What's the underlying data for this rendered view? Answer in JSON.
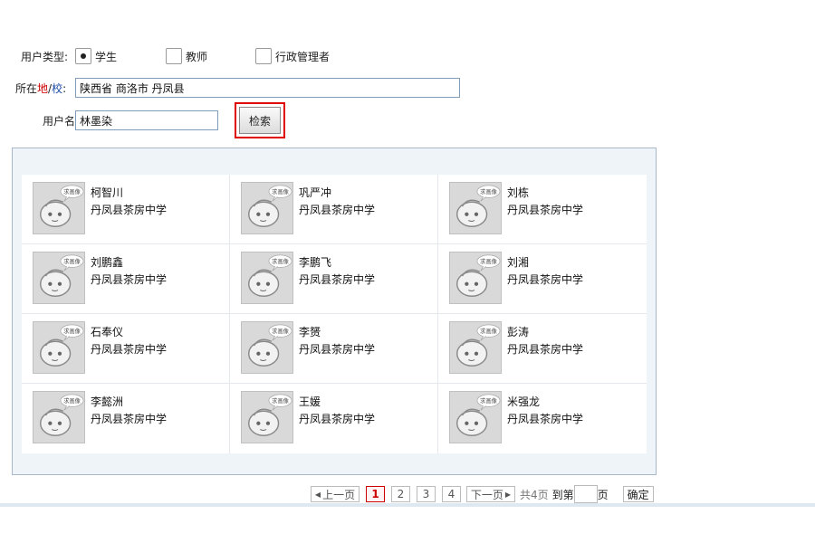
{
  "filters": {
    "user_type_label": "用户类型:",
    "user_types": [
      {
        "label": "学生",
        "checked": true
      },
      {
        "label": "教师",
        "checked": false
      },
      {
        "label": "行政管理者",
        "checked": false
      }
    ],
    "location_label_prefix": "所在",
    "location_label_di": "地",
    "location_label_sep": "/",
    "location_label_xiao": "校",
    "location_label_suffix": ":",
    "location_value": "陕西省 商洛市 丹凤县",
    "username_label": "用户名",
    "username_value": "林墨染",
    "search_button": "检索"
  },
  "results": [
    {
      "name": "柯智川",
      "school": "丹凤县茶房中学"
    },
    {
      "name": "巩严冲",
      "school": "丹凤县茶房中学"
    },
    {
      "name": "刘栋",
      "school": "丹凤县茶房中学"
    },
    {
      "name": "刘鹏鑫",
      "school": "丹凤县茶房中学"
    },
    {
      "name": "李鹏飞",
      "school": "丹凤县茶房中学"
    },
    {
      "name": "刘湘",
      "school": "丹凤县茶房中学"
    },
    {
      "name": "石奉仪",
      "school": "丹凤县茶房中学"
    },
    {
      "name": "李赟",
      "school": "丹凤县茶房中学"
    },
    {
      "name": "彭涛",
      "school": "丹凤县茶房中学"
    },
    {
      "name": "李懿洲",
      "school": "丹凤县茶房中学"
    },
    {
      "name": "王媛",
      "school": "丹凤县茶房中学"
    },
    {
      "name": "米强龙",
      "school": "丹凤县茶房中学"
    }
  ],
  "avatar_badge": "求画像",
  "pagination": {
    "prev": "上一页",
    "pages": [
      "1",
      "2",
      "3",
      "4"
    ],
    "current": "1",
    "next": "下一页",
    "total": "共4页",
    "goto_prefix": "到第",
    "goto_suffix": "页",
    "confirm": "确定"
  },
  "colors": {
    "accent_red": "#e00000",
    "link_blue": "#1a4aa5"
  }
}
